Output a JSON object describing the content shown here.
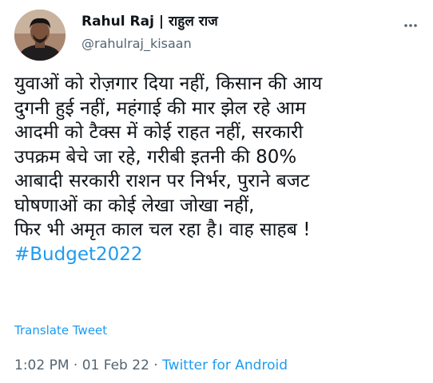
{
  "author": {
    "display_name": "Rahul Raj | राहुल राज",
    "handle": "@rahulraj_kisaan"
  },
  "tweet": {
    "lines": [
      "युवाओं को रोज़गार दिया नहीं, किसान की आय",
      "दुगनी हुई नहीं, महंगाई की मार झेल रहे आम",
      "आदमी को टैक्स में कोई राहत नहीं, सरकारी",
      "उपक्रम बेचे जा रहे, गरीबी इतनी की 80%",
      "आबादी सरकारी राशन पर निर्भर, पुराने बजट",
      "घोषणाओं का कोई लेखा जोखा नहीं,",
      "फिर भी अमृत काल चल रहा है। वाह साहब !"
    ],
    "hashtag": "#Budget2022",
    "translate_label": "Translate Tweet",
    "time": "1:02 PM",
    "date": "01 Feb 22",
    "separator": "·",
    "source": "Twitter for Android"
  },
  "icons": {
    "more": "more-dots-icon",
    "avatar": "profile-photo"
  },
  "colors": {
    "link": "#1d9bf0",
    "secondary_text": "#536471",
    "primary_text": "#0f1419"
  }
}
